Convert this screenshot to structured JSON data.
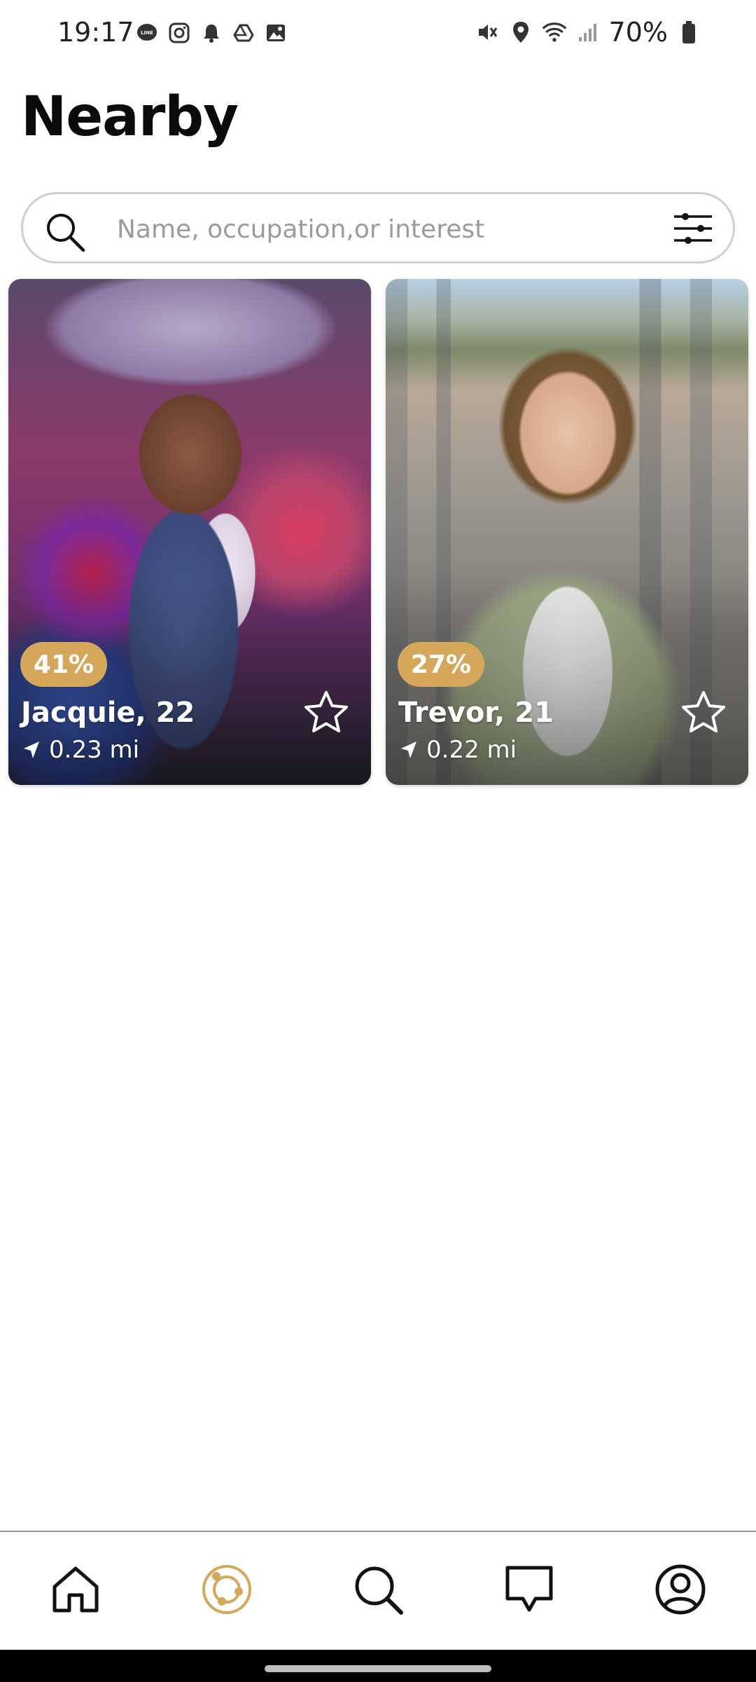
{
  "status_bar": {
    "time": "19:17",
    "left_icons": [
      "line-icon",
      "instagram-icon",
      "bell-icon",
      "drive-icon",
      "gallery-icon"
    ],
    "right_icons": [
      "mute-icon",
      "location-icon",
      "wifi-icon",
      "signal-icon"
    ],
    "battery_percent": "70%"
  },
  "header": {
    "title": "Nearby"
  },
  "search": {
    "placeholder": "Name, occupation,or interest",
    "value": ""
  },
  "cards": [
    {
      "match": "41%",
      "name": "Jacquie, 22",
      "distance": "0.23 mi",
      "favorited": false
    },
    {
      "match": "27%",
      "name": "Trevor, 21",
      "distance": "0.22 mi",
      "favorited": false
    }
  ],
  "bottom_nav": {
    "items": [
      {
        "icon": "home-icon",
        "active": false
      },
      {
        "icon": "nearby-icon",
        "active": true
      },
      {
        "icon": "search-icon",
        "active": false
      },
      {
        "icon": "chat-icon",
        "active": false
      },
      {
        "icon": "profile-icon",
        "active": false
      }
    ],
    "active_color": "#d4a75a",
    "inactive_color": "#111111"
  },
  "colors": {
    "accent": "#d4a75a",
    "background": "#ffffff",
    "text": "#0b0b0b"
  }
}
